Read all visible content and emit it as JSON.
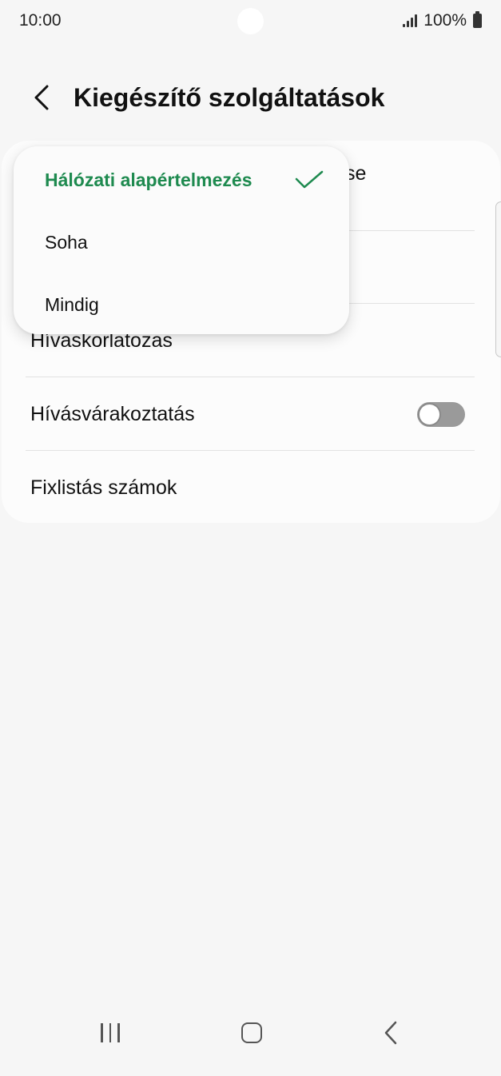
{
  "status_bar": {
    "time": "10:00",
    "battery_text": "100%",
    "icons": [
      "signal-icon",
      "battery-icon"
    ]
  },
  "header": {
    "title": "Kiegészítő szolgáltatások",
    "back_icon": "back-arrow-icon"
  },
  "settings": {
    "partial_row_text": "se",
    "items": [
      {
        "label": "Hívaskorlatozas"
      },
      {
        "label": "Hívásvárakoztatás",
        "toggle_on": false
      },
      {
        "label": "Fixlistás számok"
      }
    ]
  },
  "popup": {
    "options": [
      {
        "label": "Hálózati alapértelmezés",
        "selected": true
      },
      {
        "label": "Soha",
        "selected": false
      },
      {
        "label": "Mindig",
        "selected": false
      }
    ]
  },
  "colors": {
    "accent_green": "#1e8a4f",
    "background": "#f6f6f6",
    "card": "#fcfcfc"
  },
  "nav_bar": {
    "icons": [
      "recent-apps-icon",
      "home-icon",
      "back-icon"
    ]
  }
}
